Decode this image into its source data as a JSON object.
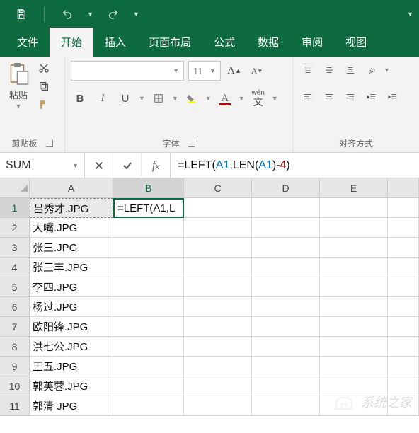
{
  "qat": {
    "save": "save",
    "undo": "undo",
    "redo": "redo"
  },
  "tabs": {
    "file": "文件",
    "home": "开始",
    "insert": "插入",
    "pageLayout": "页面布局",
    "formulas": "公式",
    "data": "数据",
    "review": "审阅",
    "view": "视图"
  },
  "ribbon": {
    "clipboard": {
      "paste": "粘贴",
      "groupLabel": "剪贴板"
    },
    "font": {
      "fontName": "",
      "fontSize": "11",
      "groupLabel": "字体",
      "bold": "B",
      "italic": "I",
      "underline": "U",
      "wen": "wén"
    },
    "align": {
      "groupLabel": "对齐方式"
    }
  },
  "nameBox": "SUM",
  "formula": {
    "prefix": "=LEFT(",
    "ref1": "A1",
    "mid": ",LEN(",
    "ref2": "A1",
    "tail": ")-",
    "num": "4",
    "end": ")"
  },
  "columns": [
    "A",
    "B",
    "C",
    "D",
    "E"
  ],
  "rows": [
    {
      "n": "1",
      "A": "吕秀才.JPG",
      "B": "=LEFT(A1,L"
    },
    {
      "n": "2",
      "A": "大嘴.JPG",
      "B": ""
    },
    {
      "n": "3",
      "A": "张三.JPG",
      "B": ""
    },
    {
      "n": "4",
      "A": "张三丰.JPG",
      "B": ""
    },
    {
      "n": "5",
      "A": "李四.JPG",
      "B": ""
    },
    {
      "n": "6",
      "A": "杨过.JPG",
      "B": ""
    },
    {
      "n": "7",
      "A": "欧阳锋.JPG",
      "B": ""
    },
    {
      "n": "8",
      "A": "洪七公.JPG",
      "B": ""
    },
    {
      "n": "9",
      "A": "王五.JPG",
      "B": ""
    },
    {
      "n": "10",
      "A": "郭芙蓉.JPG",
      "B": ""
    },
    {
      "n": "11",
      "A": "郭清 JPG",
      "B": ""
    }
  ],
  "watermark": "系统之家"
}
